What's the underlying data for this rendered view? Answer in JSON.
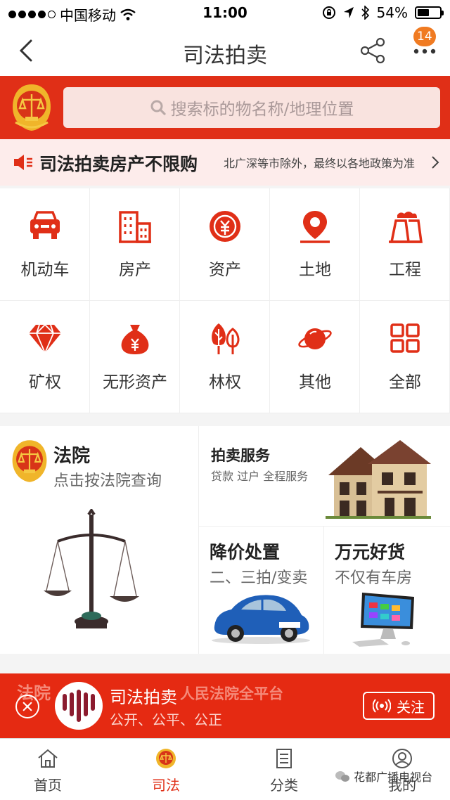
{
  "status_bar": {
    "carrier": "中国移动",
    "time": "11:00",
    "battery": "54%",
    "battery_level": 0.54
  },
  "nav": {
    "title": "司法拍卖",
    "badge": "14"
  },
  "search": {
    "placeholder": "搜索标的物名称/地理位置"
  },
  "notice": {
    "title": "司法拍卖房产不限购",
    "detail": "北广深等市除外，最终以各地政策为准"
  },
  "categories": [
    {
      "label": "机动车",
      "icon": "car-icon"
    },
    {
      "label": "房产",
      "icon": "building-icon"
    },
    {
      "label": "资产",
      "icon": "coin-icon"
    },
    {
      "label": "土地",
      "icon": "location-pin-icon"
    },
    {
      "label": "工程",
      "icon": "factory-icon"
    },
    {
      "label": "矿权",
      "icon": "diamond-icon"
    },
    {
      "label": "无形资产",
      "icon": "money-bag-icon"
    },
    {
      "label": "林权",
      "icon": "tree-icon"
    },
    {
      "label": "其他",
      "icon": "planet-icon"
    },
    {
      "label": "全部",
      "icon": "grid-icon"
    }
  ],
  "promo": {
    "court": {
      "title": "法院",
      "subtitle": "点击按法院查询"
    },
    "service": {
      "title": "拍卖服务",
      "subtitle": "贷款 过户 全程服务"
    },
    "price_cut": {
      "title": "降价处置",
      "subtitle": "二、三拍/变卖"
    },
    "goods": {
      "title": "万元好货",
      "subtitle": "不仅有车房"
    }
  },
  "follow_bar": {
    "peek_left": "法院",
    "peek_right": "人民法院全平台",
    "name": "司法拍卖",
    "slogan": "公开、公平、公正",
    "button": "关注"
  },
  "tabs": [
    {
      "label": "首页",
      "icon": "home-icon",
      "active": false
    },
    {
      "label": "司法",
      "icon": "court-emblem-icon",
      "active": true
    },
    {
      "label": "分类",
      "icon": "list-icon",
      "active": false
    },
    {
      "label": "我的",
      "icon": "user-icon",
      "active": false
    }
  ],
  "watermark": "花都广播电视台",
  "colors": {
    "brand_red": "#e02f17",
    "badge_orange": "#f07b22",
    "notice_bg": "#fdeceb"
  }
}
